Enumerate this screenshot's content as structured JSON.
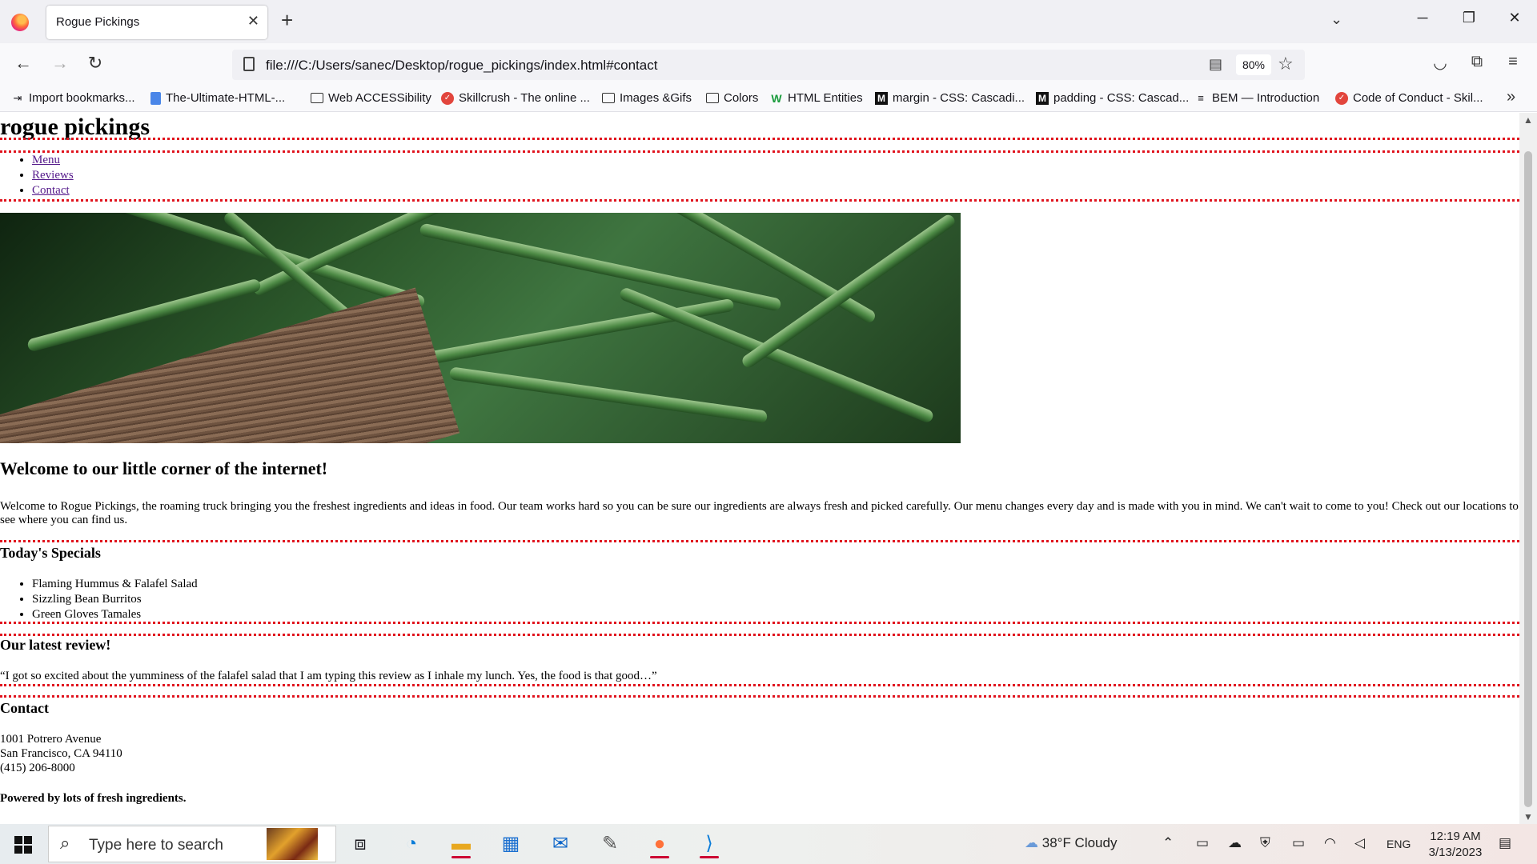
{
  "browser": {
    "tab_title": "Rogue Pickings",
    "url": "file:///C:/Users/sanec/Desktop/rogue_pickings/index.html#contact",
    "zoom": "80%",
    "bookmarks": [
      "Import bookmarks...",
      "The-Ultimate-HTML-...",
      "Web ACCESSibility",
      "Skillcrush - The online ...",
      "Images &Gifs",
      "Colors",
      "HTML Entities",
      "margin - CSS: Cascadi...",
      "padding - CSS: Cascad...",
      "BEM — Introduction",
      "Code of Conduct - Skil..."
    ]
  },
  "page": {
    "title": "rogue pickings",
    "nav": [
      "Menu",
      "Reviews",
      "Contact"
    ],
    "welcome_heading": "Welcome to our little corner of the internet!",
    "welcome_text": "Welcome to Rogue Pickings, the roaming truck bringing you the freshest ingredients and ideas in food. Our team works hard so you can be sure our ingredients are always fresh and picked carefully. Our menu changes every day and is made with you in mind. We can't wait to come to you! Check out our locations to see where you can find us.",
    "specials_heading": "Today's Specials",
    "specials": [
      "Flaming Hummus & Falafel Salad",
      "Sizzling Bean Burritos",
      "Green Gloves Tamales"
    ],
    "review_heading": "Our latest review!",
    "review_text": "“I got so excited about the yumminess of the falafel salad that I am typing this review as I inhale my lunch. Yes, the food is that good…”",
    "contact_heading": "Contact",
    "address_line1": "1001 Potrero Avenue",
    "address_line2": "San Francisco, CA 94110",
    "phone": "(415) 206-8000",
    "footer": "Powered by lots of fresh ingredients."
  },
  "taskbar": {
    "search_placeholder": "Type here to search",
    "weather": "38°F  Cloudy",
    "language": "ENG",
    "time": "12:19 AM",
    "date": "3/13/2023"
  },
  "colors": {
    "divider": "#e0141e",
    "link_visited": "#551a8b"
  }
}
